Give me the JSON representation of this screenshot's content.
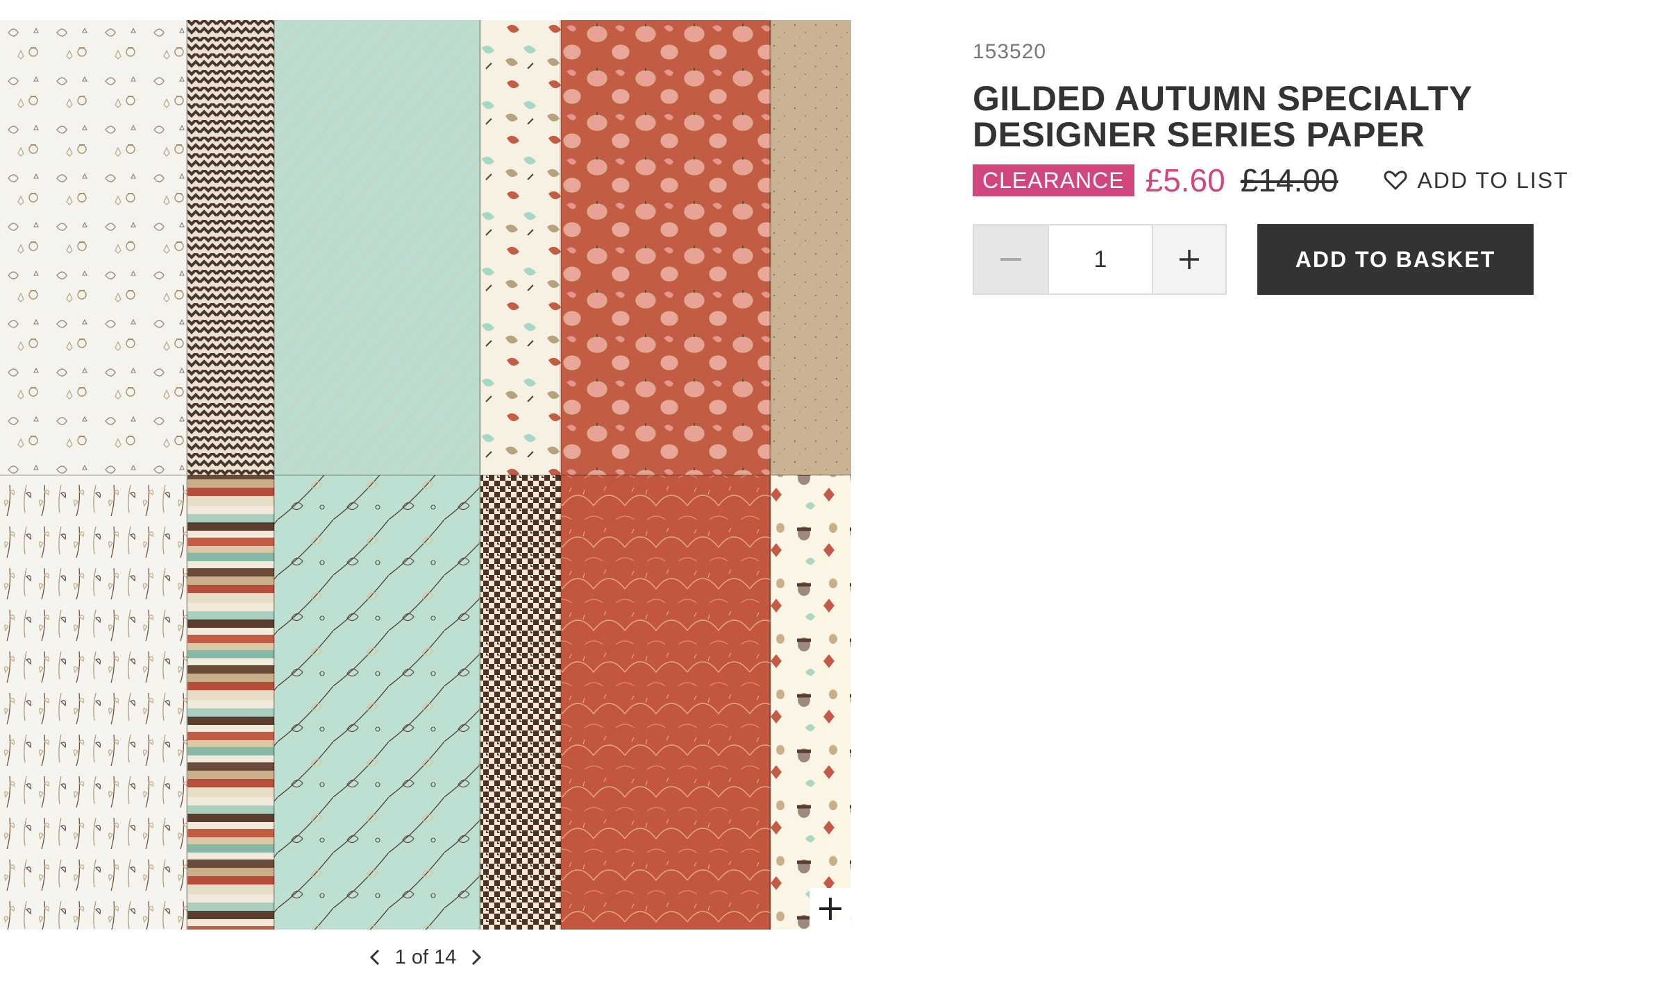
{
  "product": {
    "sku": "153520",
    "title": "GILDED AUTUMN SPECIALTY DESIGNER SERIES PAPER",
    "badge": "CLEARANCE",
    "price": "£5.60",
    "old_price": "£14.00",
    "add_to_list_label": "ADD TO LIST",
    "quantity": "1",
    "add_to_basket_label": "ADD TO BASKET"
  },
  "gallery": {
    "pager_text": "1 of 14",
    "image_alt": "Gilded Autumn Specialty Designer Series Paper patterns"
  },
  "colors": {
    "accent": "#d2467f",
    "dark": "#333333",
    "mint": "#b9dccd",
    "terracotta": "#c25c44",
    "brown": "#5a3d2e",
    "cream": "#f7f1df",
    "kraft": "#c7b08c"
  },
  "icons": {
    "heart": "heart-icon",
    "minus": "minus-icon",
    "plus": "plus-icon",
    "zoom": "zoom-plus-icon",
    "prev": "chevron-left-icon",
    "next": "chevron-right-icon"
  }
}
